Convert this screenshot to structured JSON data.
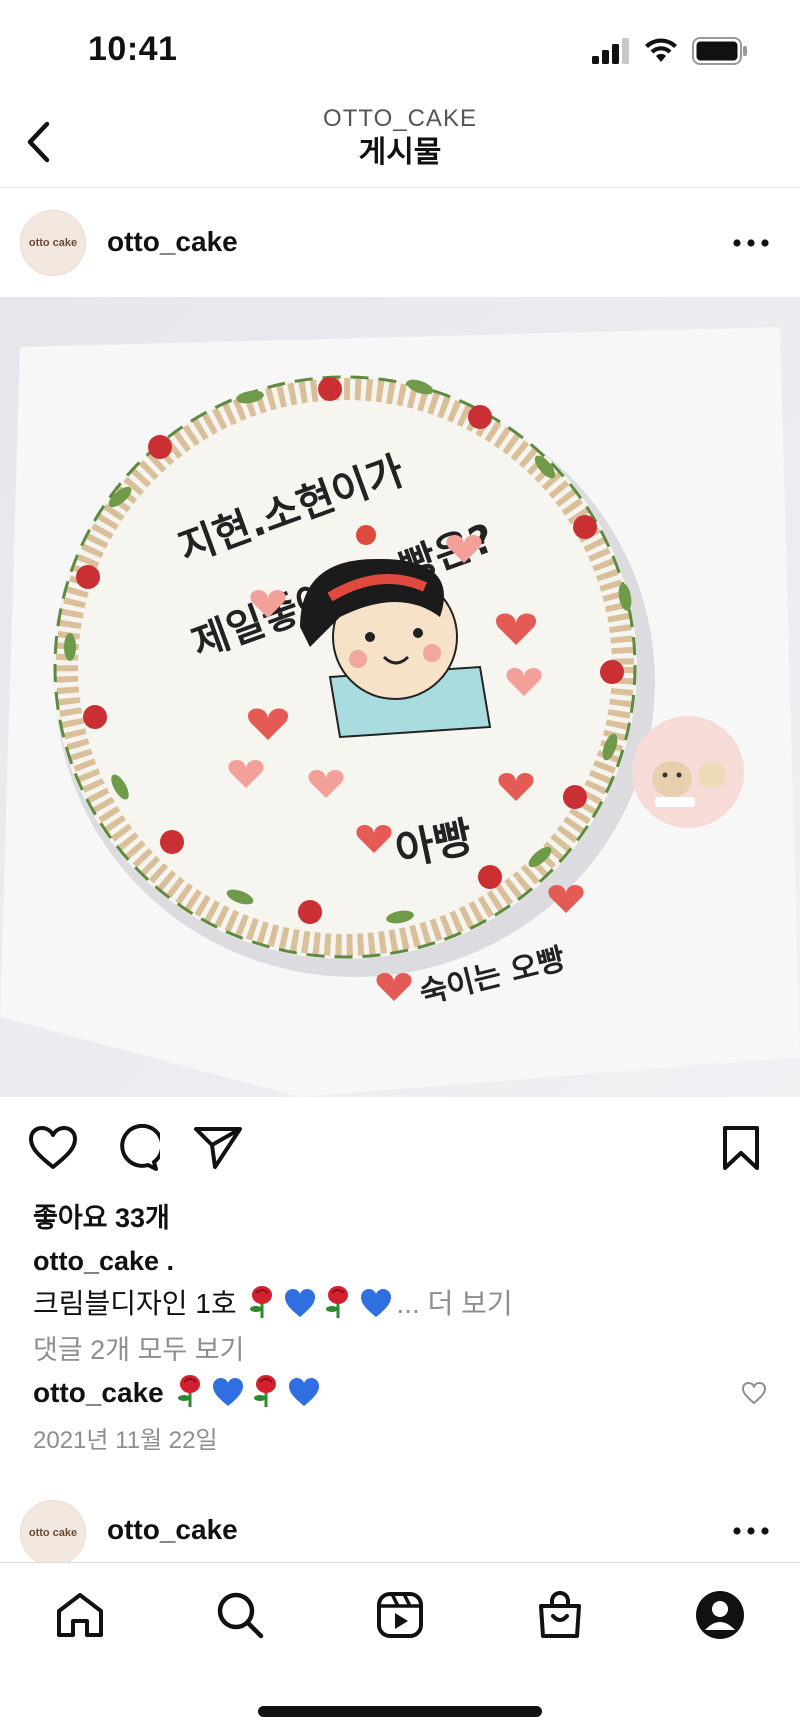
{
  "status_bar": {
    "time": "10:41"
  },
  "header": {
    "subtitle": "OTTO_CAKE",
    "title": "게시물"
  },
  "post": {
    "username": "otto_cake",
    "avatar_text": "otto cake",
    "image_text": {
      "line1": "지현.소현이가",
      "line2": "제일좋아하는빵은?",
      "answer": "아빵",
      "signature": "숙이는 오빵"
    },
    "likes": "좋아요 33개",
    "caption_user": "otto_cake .",
    "caption_text": "크림블디자인 1호",
    "caption_more": "... 더 보기",
    "view_comments": "댓글 2개 모두 보기",
    "comment_user": "otto_cake",
    "date": "2021년 11월 22일"
  },
  "next_post": {
    "username": "otto_cake",
    "avatar_text": "otto cake"
  },
  "icons": {
    "back": "chevron-left-icon",
    "more": "more-horizontal-icon",
    "like": "heart-icon",
    "comment": "comment-icon",
    "share": "send-icon",
    "save": "bookmark-icon",
    "home": "home-icon",
    "search": "search-icon",
    "reels": "reels-icon",
    "shop": "shop-icon",
    "profile": "profile-icon"
  },
  "colors": {
    "text": "#111111",
    "muted": "#8e8e8e",
    "emoji_heart": "#2f6fe0",
    "emoji_rose": "#d3202f"
  }
}
